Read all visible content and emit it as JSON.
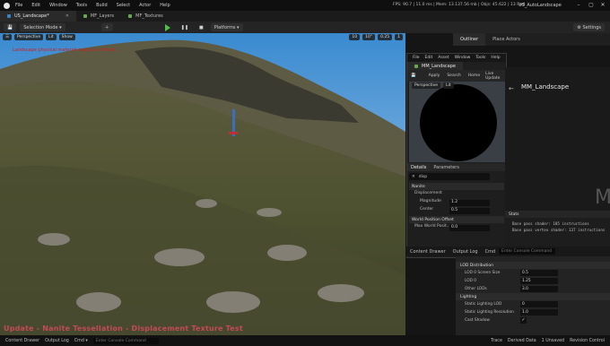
{
  "menubar": {
    "items": [
      "File",
      "Edit",
      "Window",
      "Tools",
      "Build",
      "Select",
      "Actor",
      "Help"
    ],
    "stats": "FPS: 90.7  |  11.0 ms  |  Mem: 13.137.56 mb  |  Objs: 45.622  |  13 Fwd",
    "app_title": "US_AutoLandscape"
  },
  "tabs": [
    {
      "label": "US_Landscape*",
      "active": true
    },
    {
      "label": "MF_Layers",
      "active": false
    },
    {
      "label": "MF_Textures",
      "active": false
    }
  ],
  "toolbar": {
    "selection_mode": "Selection Mode",
    "platforms": "Platforms",
    "settings": "Settings"
  },
  "viewport": {
    "chips": [
      "Perspective",
      "Lit",
      "Show"
    ],
    "snap_value": "10",
    "rot_value": "10°",
    "scale_value": "0.25",
    "cam_value": "1",
    "red_warning": "Landscape physical material output is not set...",
    "caption": "Update - Nanite Tessellation - Displacement Texture Test"
  },
  "right_tabs": {
    "outliner": "Outliner",
    "place_actors": "Place Actors"
  },
  "material_window": {
    "menu": [
      "File",
      "Edit",
      "Asset",
      "Window",
      "Tools",
      "Help"
    ],
    "tab": "MM_Landscape",
    "tools": [
      "Save",
      "Browse",
      "Apply",
      "Search",
      "Home",
      "Live Update",
      "Clean Graph"
    ],
    "preview_chips": [
      "Perspective",
      "Lit"
    ],
    "details_tab": "Details",
    "parameters_tab": "Parameters",
    "search_value": "disp",
    "sections": {
      "nanite": "Nanite",
      "world_position_offset": "World Position Offset"
    },
    "props": [
      {
        "label": "Displacement",
        "value": ""
      },
      {
        "label": "Magnitude",
        "value": "1.2"
      },
      {
        "label": "Center",
        "value": "0.5"
      },
      {
        "label": "Max World Posit...",
        "value": "0.0"
      }
    ]
  },
  "graph": {
    "breadcrumb": "MM_Landscape",
    "big_letter": "M"
  },
  "stats_panel": {
    "title": "Stats",
    "lines": [
      "Base pass shader: 185 instructions",
      "Base pass vertex shader: 137 instructions"
    ]
  },
  "bottom_tabs": [
    "Content Drawer",
    "Output Log",
    "Cmd"
  ],
  "bottom_cmd_placeholder": "Enter Console Command",
  "right_details": {
    "sections": [
      "LOD Distribution",
      "Lighting"
    ],
    "rows": [
      {
        "label": "LOD 0 Screen Size",
        "value": "0.5"
      },
      {
        "label": "LOD 0",
        "value": "1.25"
      },
      {
        "label": "Other LODs",
        "value": "3.0"
      },
      {
        "label": "Static Lighting LOD",
        "value": "0"
      },
      {
        "label": "Static Lighting Resolution",
        "value": "1.0"
      },
      {
        "label": "Cast Shadow",
        "value": ""
      }
    ]
  },
  "statusbar": {
    "content_drawer": "Content Drawer",
    "output_log": "Output Log",
    "cmd": "Cmd",
    "cmd_placeholder": "Enter Console Command",
    "trace": "Trace",
    "derived_data": "Derived Data",
    "unsaved": "1 Unsaved",
    "revision_control": "Revision Control"
  }
}
